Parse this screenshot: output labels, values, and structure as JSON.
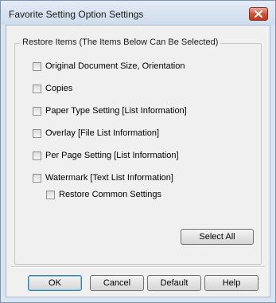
{
  "window": {
    "title": "Favorite Setting Option Settings",
    "close_icon": "close-icon"
  },
  "restore_group": {
    "label": "Restore Items (The Items Below Can Be Selected)",
    "items": [
      {
        "label": "Original Document Size, Orientation",
        "checked": false
      },
      {
        "label": "Copies",
        "checked": false
      },
      {
        "label": "Paper Type Setting [List Information]",
        "checked": false
      },
      {
        "label": "Overlay [File List Information]",
        "checked": false
      },
      {
        "label": "Per Page Setting [List Information]",
        "checked": false
      },
      {
        "label": "Watermark [Text List Information]",
        "checked": false
      }
    ],
    "sub_item": {
      "label": "Restore Common Settings",
      "checked": false
    },
    "select_all_label": "Select All"
  },
  "buttons": {
    "ok": "OK",
    "cancel": "Cancel",
    "default": "Default",
    "help": "Help"
  }
}
